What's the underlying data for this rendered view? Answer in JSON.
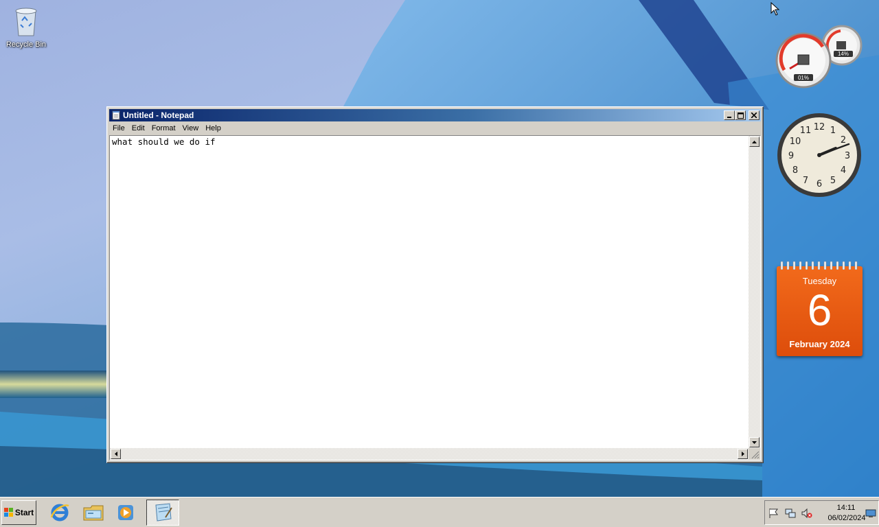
{
  "desktop": {
    "icons": [
      {
        "label": "Recycle Bin",
        "icon": "recycle-bin-icon"
      }
    ]
  },
  "notepad": {
    "title": "Untitled - Notepad",
    "menus": [
      "File",
      "Edit",
      "Format",
      "View",
      "Help"
    ],
    "content": "what should we do if"
  },
  "gadgets": {
    "cpu_meter": {
      "cpu": "01%",
      "memory": "14%"
    },
    "clock": {
      "numbers": [
        "12",
        "1",
        "2",
        "3",
        "4",
        "5",
        "6",
        "7",
        "8",
        "9",
        "10",
        "11"
      ],
      "time": "14:11"
    },
    "calendar": {
      "weekday": "Tuesday",
      "day": "6",
      "month_year": "February 2024"
    }
  },
  "taskbar": {
    "start_label": "Start",
    "items": [
      "internet-explorer-icon",
      "windows-explorer-icon",
      "media-player-icon",
      "notepad-icon"
    ],
    "tray": {
      "time": "14:11",
      "date": "06/02/2024"
    }
  },
  "colors": {
    "title_gradient_start": "#0a246a",
    "title_gradient_end": "#a6caf0",
    "calendar_orange": "#f26a1b",
    "chrome_gray": "#d4d0c8"
  }
}
